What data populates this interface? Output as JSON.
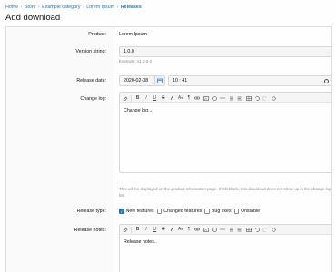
{
  "breadcrumb": {
    "items": [
      "Home",
      "Store",
      "Example category",
      "Lorem Ipsum",
      "Releases"
    ],
    "separator": "›"
  },
  "page": {
    "title": "Add download"
  },
  "form": {
    "product": {
      "label": "Product:",
      "value": "Lorem Ipsum"
    },
    "version": {
      "label": "Version string:",
      "value": "1.0.0",
      "hint": "Example: v1.0.0.0"
    },
    "release_date": {
      "label": "Release date:",
      "date": "2020-02-08",
      "time": "10 : 41"
    },
    "change_log": {
      "label": "Change log:",
      "body": "Change log...",
      "hint": "This will be displayed on the product information page. If left blank, this download does not show up in the change log list."
    },
    "release_type": {
      "label": "Release type:",
      "options": [
        {
          "label": "New features",
          "checked": true
        },
        {
          "label": "Changed features",
          "checked": false
        },
        {
          "label": "Bug fixes",
          "checked": false
        },
        {
          "label": "Unstable",
          "checked": false
        }
      ]
    },
    "release_notes": {
      "label": "Release notes:",
      "body": "Release notes.."
    }
  },
  "toolbar": {
    "buttons": [
      "eraser-icon",
      "bold-icon",
      "italic-icon",
      "underline-icon",
      "strikethrough-icon",
      "color-icon",
      "font-size-icon",
      "paragraph-icon",
      "link-icon",
      "image-icon",
      "emoji-icon",
      "more-icon",
      "list-icon",
      "align-icon",
      "table-icon",
      "undo-icon",
      "redo-icon",
      "settings-icon"
    ],
    "glyphs": {
      "bold": "B",
      "italic": "I",
      "underline": "U",
      "strike": "S",
      "font_size": "A",
      "paragraph": "¶",
      "caret": "▾"
    }
  },
  "colors": {
    "accent": "#2577b1",
    "checkbox_checked": "#2577b1",
    "panel_bg": "#fafafa"
  }
}
